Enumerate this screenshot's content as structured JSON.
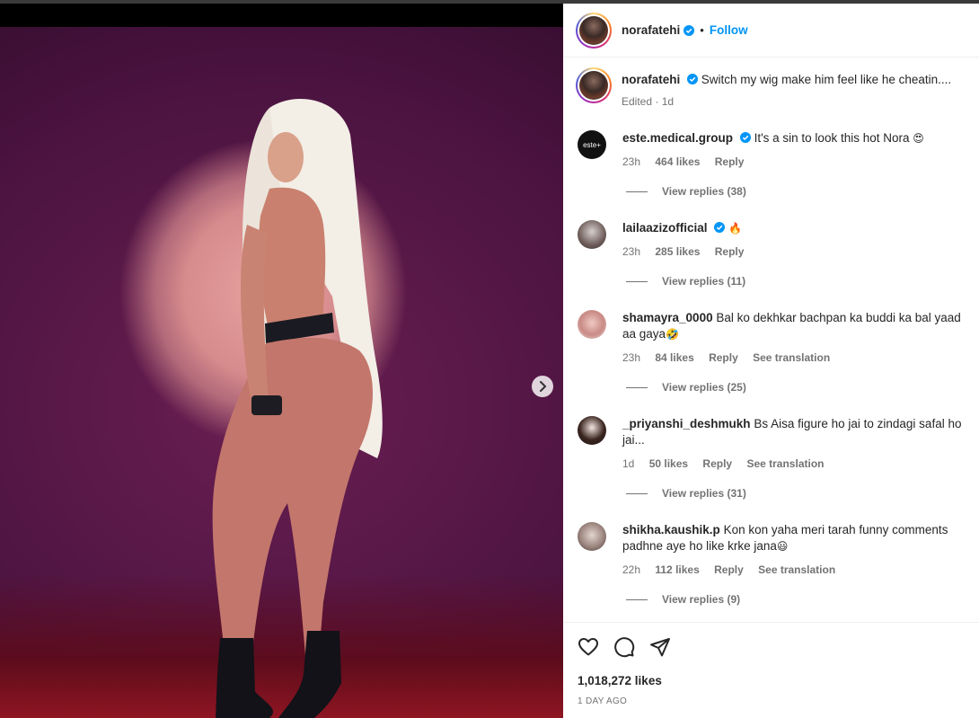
{
  "post": {
    "username": "norafatehi",
    "follow_label": "Follow",
    "separator": "•",
    "caption_text": "Switch my wig make him feel like he cheatin....",
    "edited_label": "Edited · 1d"
  },
  "comments": [
    {
      "username": "este.medical.group",
      "verified": true,
      "text": "It's a sin to look this hot Nora",
      "emoji": "😍",
      "time": "23h",
      "likes": "464 likes",
      "reply": "Reply",
      "translation": "",
      "view_replies": "View replies (38)"
    },
    {
      "username": "lailaazizofficial",
      "verified": true,
      "text": "",
      "emoji": "🔥",
      "time": "23h",
      "likes": "285 likes",
      "reply": "Reply",
      "translation": "",
      "view_replies": "View replies (11)"
    },
    {
      "username": "shamayra_0000",
      "verified": false,
      "text": "Bal ko dekhkar bachpan ka buddi ka bal yaad aa gaya",
      "emoji": "🤣",
      "time": "23h",
      "likes": "84 likes",
      "reply": "Reply",
      "translation": "See translation",
      "view_replies": "View replies (25)"
    },
    {
      "username": "_priyanshi_deshmukh",
      "verified": false,
      "text": "Bs Aisa figure ho jai to zindagi safal ho jai...",
      "emoji": "",
      "time": "1d",
      "likes": "50 likes",
      "reply": "Reply",
      "translation": "See translation",
      "view_replies": "View replies (31)"
    },
    {
      "username": "shikha.kaushik.p",
      "verified": false,
      "text": "Kon kon yaha meri tarah funny comments padhne aye ho like krke jana",
      "emoji": "😃",
      "time": "22h",
      "likes": "112 likes",
      "reply": "Reply",
      "translation": "See translation",
      "view_replies": "View replies (9)"
    }
  ],
  "footer": {
    "likes": "1,018,272 likes",
    "time_ago": "1 DAY AGO"
  },
  "icons": [
    "heart-icon",
    "comment-icon",
    "share-icon",
    "next-arrow-icon",
    "verified-icon"
  ],
  "colors": {
    "accent": "#0095f6",
    "verified": "#0095f6",
    "muted": "#737373"
  }
}
